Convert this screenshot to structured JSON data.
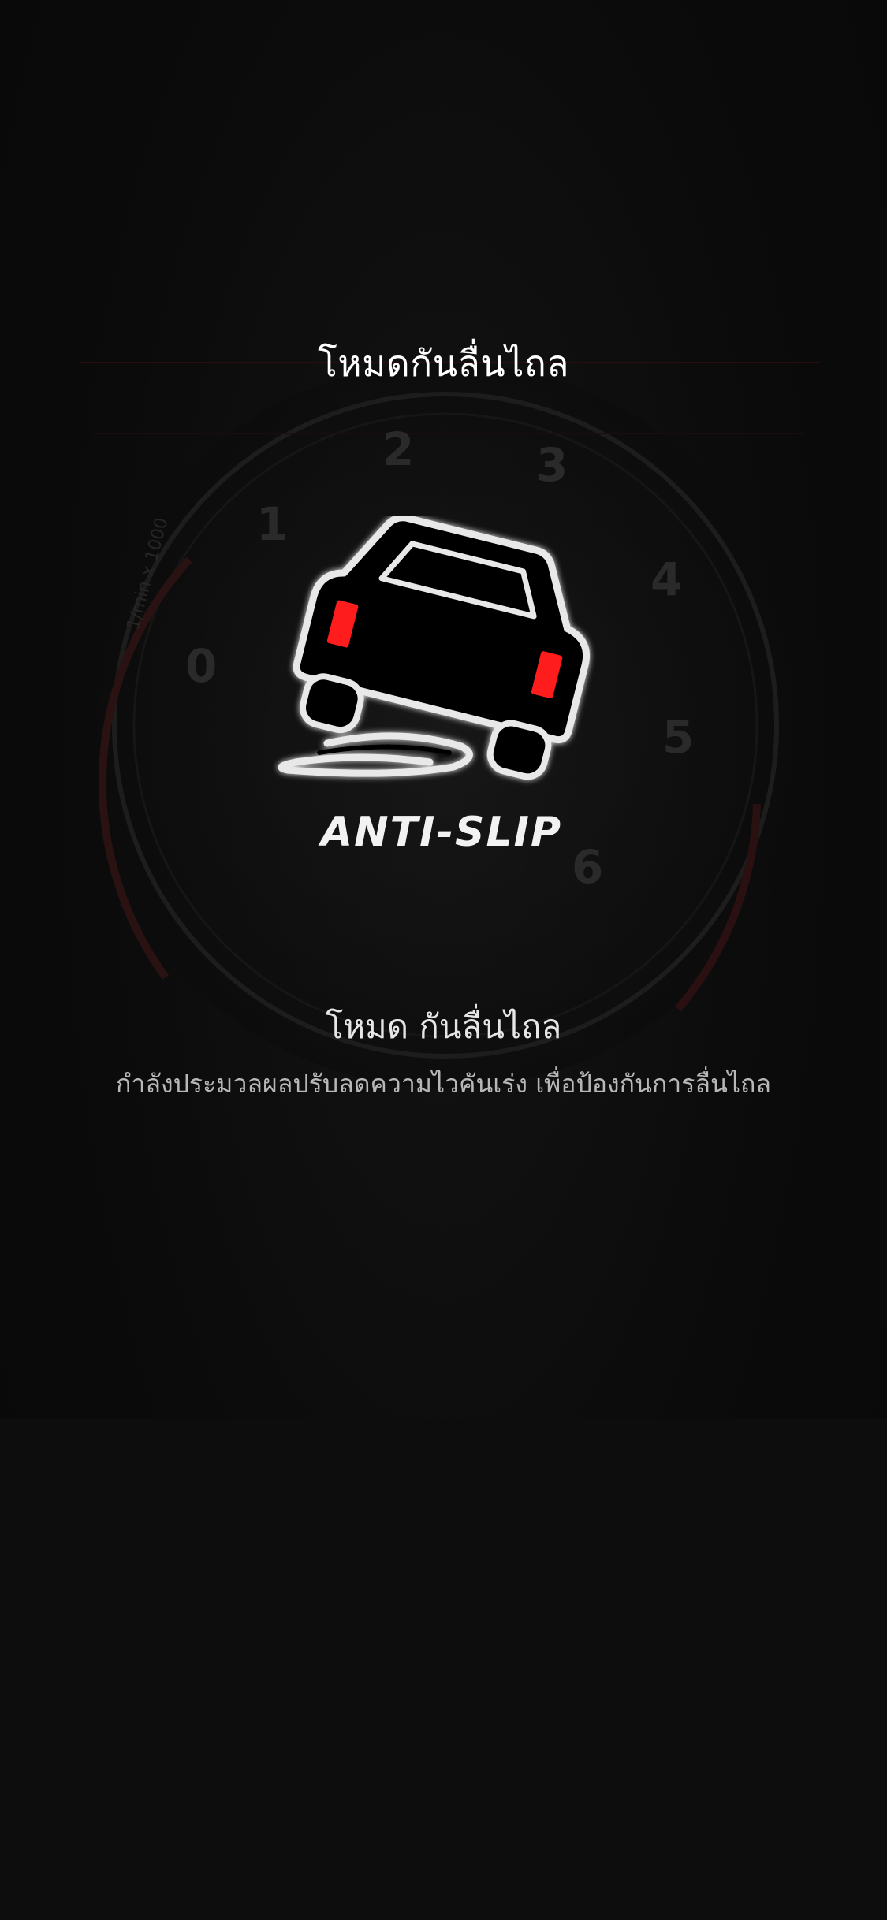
{
  "screen": {
    "title": "โหมดกันลื่นไถล"
  },
  "logo": {
    "caption": "ANTI-SLIP"
  },
  "gauge": {
    "unit_label": "1/min x 1000",
    "ticks": [
      "0",
      "1",
      "2",
      "3",
      "4",
      "5",
      "6"
    ]
  },
  "mode": {
    "name": "โหมด กันลื่นไถล",
    "description": "กำลังประมวลผลปรับลดความไวคันเร่ง เพื่อป้องกันการลื่นไถล"
  },
  "colors": {
    "background": "#0a0a0a",
    "accent_red": "#ff1a1a",
    "text_primary": "#ffffff",
    "text_secondary": "#b8b8b8"
  },
  "icons": [
    "anti-slip-car-icon",
    "tachometer-gauge"
  ]
}
